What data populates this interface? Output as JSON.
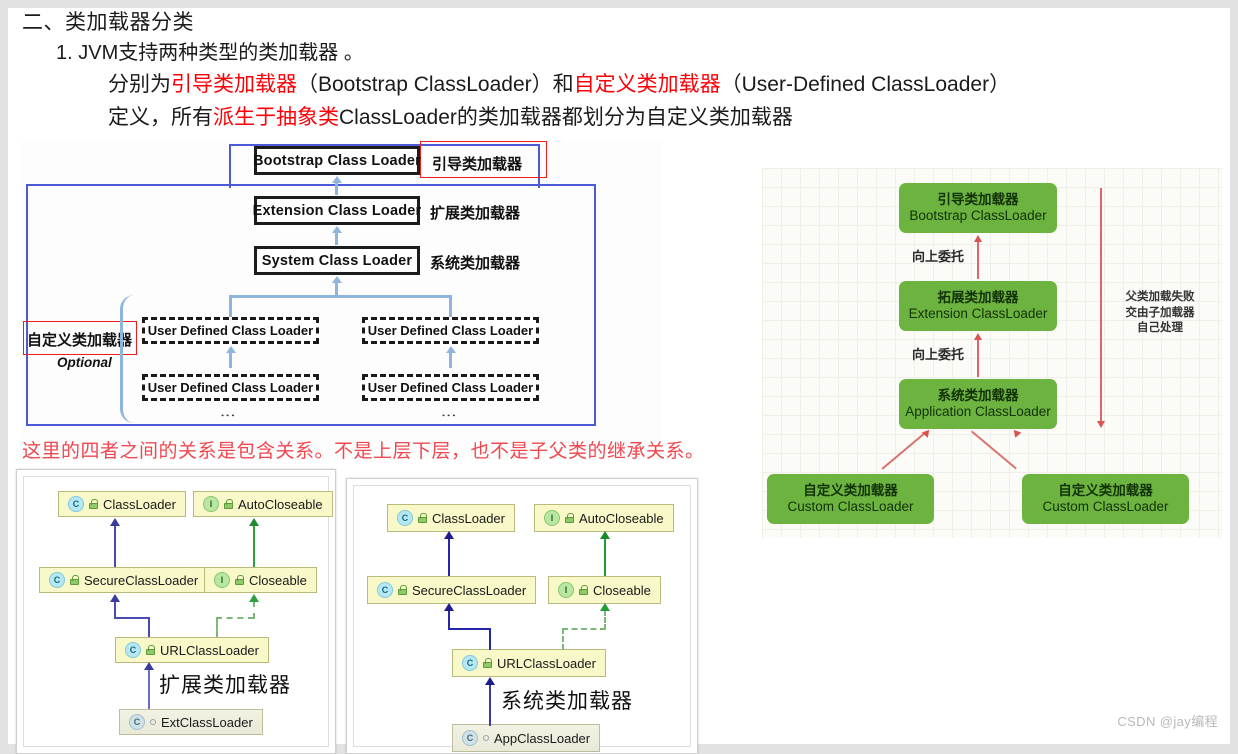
{
  "heading": {
    "line1": "二、类加载器分类",
    "line2": "1. JVM支持两种类型的类加载器 。",
    "line3": {
      "p1": "分别为",
      "r1": "引导类加载器",
      "p2": "（Bootstrap ClassLoader）和",
      "r2": "自定义类加载器",
      "p3": "（User-Defined ClassLoader）"
    },
    "line4": {
      "p1": "定义，所有",
      "r1": "派生于抽象类",
      "p2": "ClassLoader的类加载器都划分为自定义类加载器"
    }
  },
  "diagram_hierarchy": {
    "boxes": {
      "bootstrap": "Bootstrap Class Loader",
      "extension": "Extension Class Loader",
      "system": "System Class Loader",
      "udl1": "User Defined Class Loader",
      "udl2": "User Defined Class Loader",
      "udl3": "User Defined Class Loader",
      "udl4": "User Defined Class Loader"
    },
    "annotations": {
      "bootstrap_cn": "引导类加载器",
      "extension_cn": "扩展类加载器",
      "system_cn": "系统类加载器",
      "custom_cn": "自定义类加载器",
      "optional": "Optional",
      "dots1": "⋮",
      "dots2": "⋮"
    },
    "note": "这里的四者之间的关系是包含关系。不是上层下层，也不是子父类的继承关系。"
  },
  "diagram_delegation": {
    "boxes": [
      {
        "zh": "引导类加载器",
        "en": "Bootstrap ClassLoader"
      },
      {
        "zh": "拓展类加载器",
        "en": "Extension ClassLoader"
      },
      {
        "zh": "系统类加载器",
        "en": "Application ClassLoader"
      },
      {
        "zh": "自定义类加载器",
        "en": "Custom ClassLoader"
      },
      {
        "zh": "自定义类加载器",
        "en": "Custom ClassLoader"
      }
    ],
    "delegate_label_1": "向上委托",
    "delegate_label_2": "向上委托",
    "side_note": "父类加载失败\n交由子加载器\n自己处理",
    "box_color": "#6db33f",
    "arrow_color": "#d9534f"
  },
  "uml_ext": {
    "nodes": {
      "classloader": "ClassLoader",
      "autocloseable": "AutoCloseable",
      "secureclassloader": "SecureClassLoader",
      "closeable": "Closeable",
      "urlclassloader": "URLClassLoader",
      "leaf": "ExtClassLoader"
    },
    "label": "扩展类加载器"
  },
  "uml_app": {
    "nodes": {
      "classloader": "ClassLoader",
      "autocloseable": "AutoCloseable",
      "secureclassloader": "SecureClassLoader",
      "closeable": "Closeable",
      "urlclassloader": "URLClassLoader",
      "leaf": "AppClassLoader"
    },
    "label": "系统类加载器"
  },
  "watermark": "CSDN @jay编程"
}
